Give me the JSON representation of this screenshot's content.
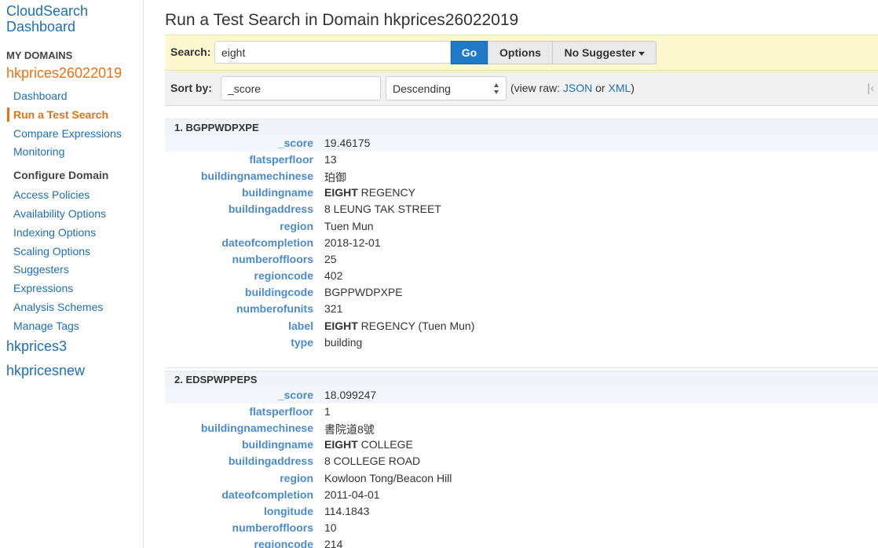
{
  "sidebar": {
    "brand_line1": "CloudSearch",
    "brand_line2": "Dashboard",
    "section_label": "MY DOMAINS",
    "active_domain": "hkprices26022019",
    "items": [
      {
        "label": "Dashboard"
      },
      {
        "label": "Run a Test Search"
      },
      {
        "label": "Compare Expressions"
      },
      {
        "label": "Monitoring"
      }
    ],
    "configure_heading": "Configure Domain",
    "config_items": [
      {
        "label": "Access Policies"
      },
      {
        "label": "Availability Options"
      },
      {
        "label": "Indexing Options"
      },
      {
        "label": "Scaling Options"
      },
      {
        "label": "Suggesters"
      },
      {
        "label": "Expressions"
      },
      {
        "label": "Analysis Schemes"
      },
      {
        "label": "Manage Tags"
      }
    ],
    "other_domains": [
      "hkprices3",
      "hkpricesnew"
    ]
  },
  "page": {
    "title": "Run a Test Search in Domain hkprices26022019"
  },
  "search": {
    "label": "Search:",
    "value": "eight",
    "go_label": "Go",
    "options_label": "Options",
    "suggester_label": "No Suggester"
  },
  "sort": {
    "label": "Sort by:",
    "field_value": "_score",
    "order_value": "Descending",
    "view_raw_prefix": "(view raw:",
    "json_label": "JSON",
    "or_text": "or",
    "xml_label": "XML",
    "view_raw_suffix": ")",
    "pager_first": "|‹"
  },
  "results": [
    {
      "title": "1. BGPPWDPXPE",
      "fields": [
        {
          "key": "_score",
          "value": "19.46175"
        },
        {
          "key": "flatsperfloor",
          "value": "13"
        },
        {
          "key": "buildingnamechinese",
          "value": "珀御"
        },
        {
          "key": "buildingname",
          "bold": "EIGHT",
          "value": " REGENCY"
        },
        {
          "key": "buildingaddress",
          "value": "8 LEUNG TAK STREET"
        },
        {
          "key": "region",
          "value": "Tuen Mun"
        },
        {
          "key": "dateofcompletion",
          "value": "2018-12-01"
        },
        {
          "key": "numberoffloors",
          "value": "25"
        },
        {
          "key": "regioncode",
          "value": "402"
        },
        {
          "key": "buildingcode",
          "value": "BGPPWDPXPE"
        },
        {
          "key": "numberofunits",
          "value": "321"
        },
        {
          "key": "label",
          "bold": "EIGHT",
          "value": " REGENCY (Tuen Mun)"
        },
        {
          "key": "type",
          "value": "building"
        }
      ]
    },
    {
      "title": "2. EDSPWPPEPS",
      "fields": [
        {
          "key": "_score",
          "value": "18.099247"
        },
        {
          "key": "flatsperfloor",
          "value": "1"
        },
        {
          "key": "buildingnamechinese",
          "value": "書院道8號"
        },
        {
          "key": "buildingname",
          "bold": "EIGHT",
          "value": " COLLEGE"
        },
        {
          "key": "buildingaddress",
          "value": "8 COLLEGE ROAD"
        },
        {
          "key": "region",
          "value": "Kowloon Tong/Beacon Hill"
        },
        {
          "key": "dateofcompletion",
          "value": "2011-04-01"
        },
        {
          "key": "longitude",
          "value": "114.1843"
        },
        {
          "key": "numberoffloors",
          "value": "10"
        },
        {
          "key": "regioncode",
          "value": "214"
        }
      ]
    }
  ]
}
